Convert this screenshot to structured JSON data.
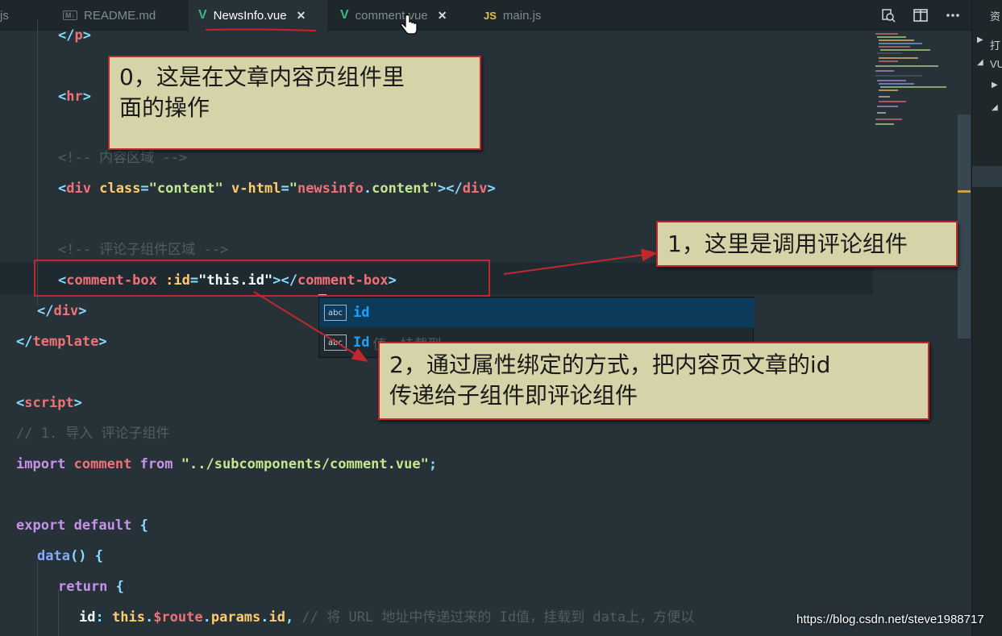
{
  "tabs": [
    {
      "label": "js",
      "icon": "",
      "active": false,
      "closable": false
    },
    {
      "label": "README.md",
      "icon": "M↓",
      "active": false,
      "closable": false
    },
    {
      "label": "NewsInfo.vue",
      "icon": "V",
      "active": true,
      "closable": true
    },
    {
      "label": "comment.vue",
      "icon": "V",
      "active": false,
      "closable": true
    },
    {
      "label": "main.js",
      "icon": "JS",
      "active": false,
      "closable": false
    }
  ],
  "tab_close_glyph": "✕",
  "side_panel": {
    "item1": "打",
    "item2": "VU",
    "top": "资"
  },
  "code": {
    "l1": [
      "</",
      "p",
      ">"
    ],
    "l2": [
      "<",
      "hr",
      ">"
    ],
    "l3": "<!-- 内容区域 -->",
    "l4": [
      "<",
      "div",
      " ",
      "class",
      "=",
      "\"content\"",
      " ",
      "v-html",
      "=",
      "\"",
      "newsinfo",
      ".",
      "content",
      "\"",
      "></",
      "div",
      ">"
    ],
    "l5": "<!-- 评论子组件区域 -->",
    "l6": [
      "<",
      "comment-box",
      " ",
      ":id",
      "=",
      "\"",
      "this",
      ".",
      "id",
      "\"",
      "></",
      "comment-box",
      ">"
    ],
    "l7": [
      "</",
      "div",
      ">"
    ],
    "l8": [
      "</",
      "template",
      ">"
    ],
    "l9": [
      "<",
      "script",
      ">"
    ],
    "l10": "// 1. 导入 评论子组件",
    "l11": [
      "import",
      " ",
      "comment",
      " ",
      "from",
      " ",
      "\"../subcomponents/comment.vue\"",
      ";"
    ],
    "l12": [
      "export",
      " ",
      "default",
      " ",
      "{"
    ],
    "l13": [
      "data",
      "()",
      " ",
      "{"
    ],
    "l14": [
      "return",
      " ",
      "{"
    ],
    "l15": [
      "id",
      ":",
      " ",
      "this",
      ".",
      "$route",
      ".",
      "params",
      ".",
      "id",
      ",",
      " ",
      "// 将 URL 地址中传递过来的 Id值，挂载到 data上，方便以"
    ]
  },
  "suggestions": [
    {
      "icon": "abc",
      "label": "id",
      "tail": "",
      "selected": true
    },
    {
      "icon": "abc",
      "label": "Id",
      "tail": "值，挂载到",
      "selected": false
    }
  ],
  "callouts": {
    "c0": {
      "line1": "0，这是在文章内容页组件里",
      "line2": "面的操作"
    },
    "c1": {
      "line1": "1，这里是调用评论组件"
    },
    "c2": {
      "line1": "2，通过属性绑定的方式，把内容页文章的id",
      "line2": "传递给子组件即评论组件"
    }
  },
  "watermark": "https://blog.csdn.net/steve1988717",
  "colors": {
    "editor_bg": "#263238",
    "callout_bg": "#d6d3a8",
    "callout_border": "#c0282d",
    "tag": "#f07178",
    "attr": "#ffcb6b",
    "string": "#c3e88d",
    "keyword": "#c792ea"
  }
}
